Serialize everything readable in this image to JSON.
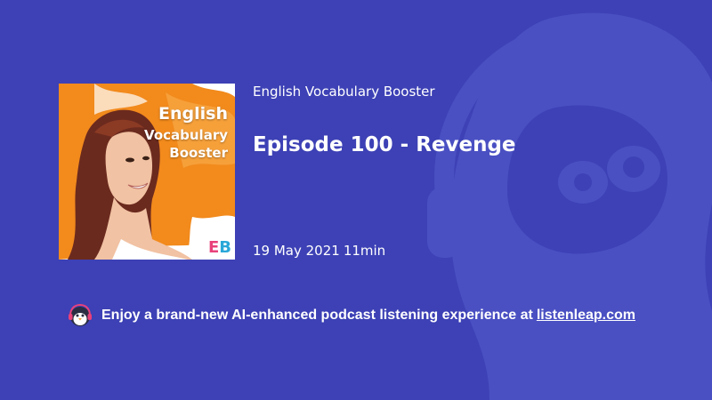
{
  "episode": {
    "podcast_name": "English Vocabulary Booster",
    "title": "Episode 100 - Revenge",
    "date": "19 May 2021",
    "duration": "11min"
  },
  "cover_art": {
    "title_line1": "English",
    "title_line2": "Vocabulary",
    "title_line3": "Booster",
    "logo_e": "E",
    "logo_b": "B"
  },
  "promo": {
    "text": "Enjoy a brand-new AI-enhanced podcast listening experience at",
    "link_text": "listenleap.com",
    "icon": "penguin-headphones-icon"
  },
  "colors": {
    "background": "#3d41b5",
    "mascot_overlay": "#4a50c2",
    "cover_orange": "#f28a1c",
    "logo_pink": "#e8417a",
    "logo_blue": "#2aa7d8"
  }
}
